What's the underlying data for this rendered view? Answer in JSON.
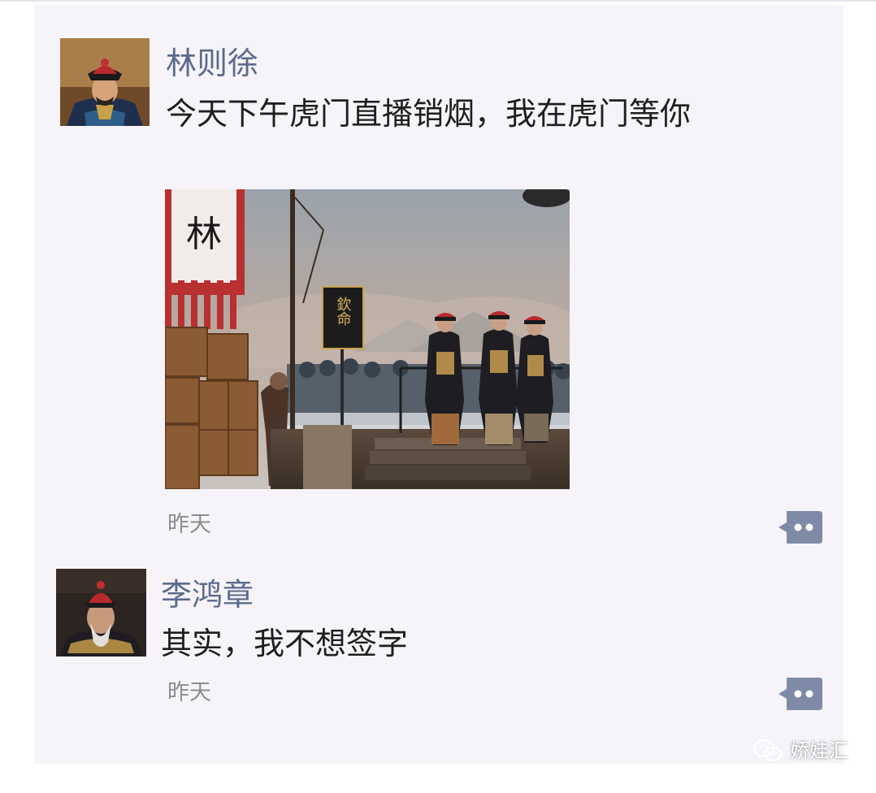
{
  "posts": [
    {
      "author": "林则徐",
      "text": "今天下午虎门直播销烟，我在虎门等你",
      "time": "昨天",
      "image_sign": "欽命",
      "image_banner": "林"
    },
    {
      "author": "李鸿章",
      "text": "其实，我不想签字",
      "time": "昨天"
    }
  ],
  "watermark": {
    "text": "娇娃汇",
    "icon": "wechat-icon"
  },
  "colors": {
    "name": "#5b6a8c",
    "text": "#1e1e1e",
    "time": "#8d8d8d",
    "card_bg": "#f6f4f8",
    "comment_button": "#7f8aa6"
  }
}
